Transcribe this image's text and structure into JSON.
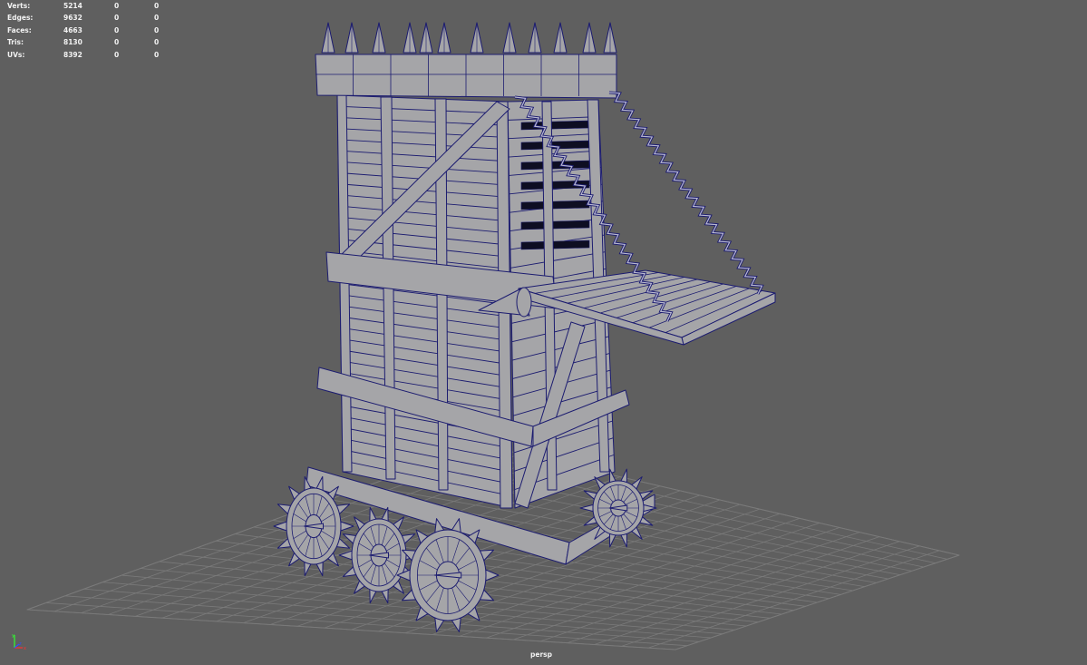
{
  "hud": {
    "rows": [
      {
        "label": "Verts:",
        "values": [
          "5214",
          "0",
          "0"
        ]
      },
      {
        "label": "Edges:",
        "values": [
          "9632",
          "0",
          "0"
        ]
      },
      {
        "label": "Faces:",
        "values": [
          "4663",
          "0",
          "0"
        ]
      },
      {
        "label": "Tris:",
        "values": [
          "8130",
          "0",
          "0"
        ]
      },
      {
        "label": "UVs:",
        "values": [
          "8392",
          "0",
          "0"
        ]
      }
    ]
  },
  "viewport": {
    "camera_label": "persp",
    "model": "siege-tower",
    "display_mode": "smooth-shade-wireframe-on-shaded"
  },
  "axis_gizmo": {
    "labels": [
      "y",
      "z",
      "x"
    ]
  },
  "colors": {
    "background": "#5f5f5f",
    "grid": "#7a7a7a",
    "wood_fill": "#a5a5a8",
    "wireframe": "#1c1c70",
    "hud_text": "#f2f2f2",
    "axis_x": "#ff3030",
    "axis_y": "#30ff30",
    "axis_z": "#3050ff"
  }
}
